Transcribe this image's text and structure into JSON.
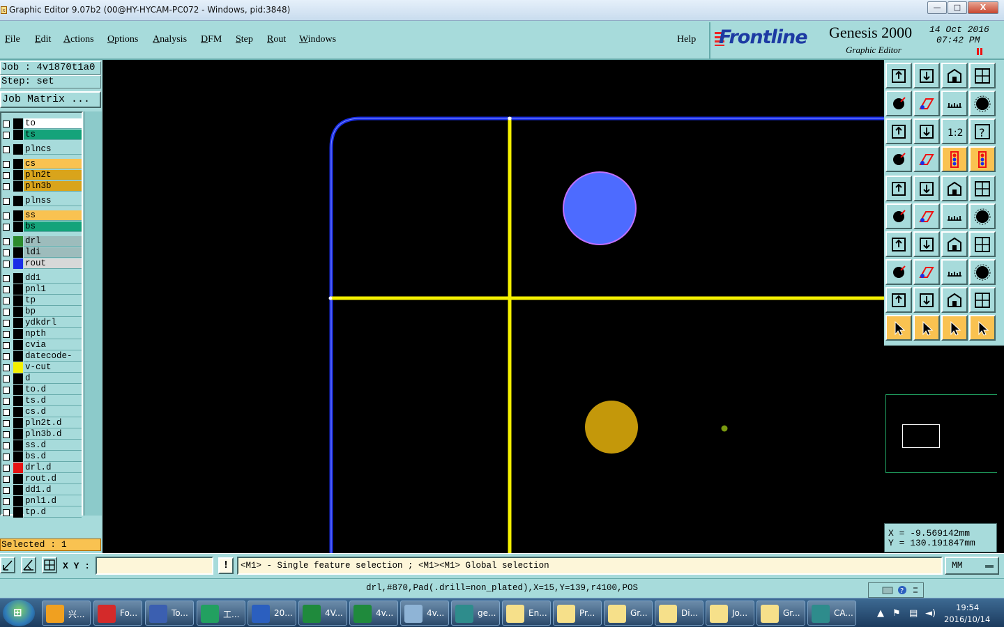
{
  "window": {
    "title": "Graphic Editor 9.07b2 (00@HY-HYCAM-PC072 - Windows, pid:3848)",
    "min_label": "—",
    "max_label": "□",
    "close_label": "X"
  },
  "menu": {
    "items": [
      "File",
      "Edit",
      "Actions",
      "Options",
      "Analysis",
      "DFM",
      "Step",
      "Rout",
      "Windows"
    ],
    "help": "Help"
  },
  "brand": {
    "logo": "Frontline",
    "product": "Genesis 2000",
    "subtitle": "Graphic Editor",
    "date": "14 Oct 2016",
    "time": "07:42 PM"
  },
  "job": {
    "job_label": "Job : 4v1870t1a0",
    "step_label": "Step: set",
    "matrix_button": "Job Matrix ..."
  },
  "layers": [
    {
      "name": "to",
      "bg": "#ffffff",
      "swatch": "#000000"
    },
    {
      "name": "ts",
      "bg": "#14a37a",
      "swatch": "#000000"
    },
    {
      "name": "plncs",
      "bg": "#a7dbdb",
      "swatch": "#000000"
    },
    {
      "name": "cs",
      "bg": "#f9c251",
      "swatch": "#000000"
    },
    {
      "name": "pln2t",
      "bg": "#d9a41b",
      "swatch": "#000000"
    },
    {
      "name": "pln3b",
      "bg": "#d9a41b",
      "swatch": "#000000"
    },
    {
      "name": "plnss",
      "bg": "#a7dbdb",
      "swatch": "#000000"
    },
    {
      "name": "ss",
      "bg": "#f9c251",
      "swatch": "#000000"
    },
    {
      "name": "bs",
      "bg": "#14a37a",
      "swatch": "#000000"
    },
    {
      "name": "drl",
      "bg": "#9dbcbc",
      "swatch": "#2d8a2d"
    },
    {
      "name": "ldi",
      "bg": "#9dbcbc",
      "swatch": "#000000"
    },
    {
      "name": "rout",
      "bg": "#d8d8d8",
      "swatch": "#1a2ee6"
    },
    {
      "name": "dd1",
      "bg": "#a7dbdb",
      "swatch": "#000000"
    },
    {
      "name": "pnl1",
      "bg": "#a7dbdb",
      "swatch": "#000000"
    },
    {
      "name": "tp",
      "bg": "#a7dbdb",
      "swatch": "#000000"
    },
    {
      "name": "bp",
      "bg": "#a7dbdb",
      "swatch": "#000000"
    },
    {
      "name": "ydkdrl",
      "bg": "#a7dbdb",
      "swatch": "#000000"
    },
    {
      "name": "npth",
      "bg": "#a7dbdb",
      "swatch": "#000000"
    },
    {
      "name": "cvia",
      "bg": "#a7dbdb",
      "swatch": "#000000"
    },
    {
      "name": "datecode-ts",
      "bg": "#a7dbdb",
      "swatch": "#000000"
    },
    {
      "name": "v-cut",
      "bg": "#a7dbdb",
      "swatch": "#f4f000"
    },
    {
      "name": "d",
      "bg": "#a7dbdb",
      "swatch": "#000000"
    },
    {
      "name": "to.d",
      "bg": "#a7dbdb",
      "swatch": "#000000"
    },
    {
      "name": "ts.d",
      "bg": "#a7dbdb",
      "swatch": "#000000"
    },
    {
      "name": "cs.d",
      "bg": "#a7dbdb",
      "swatch": "#000000"
    },
    {
      "name": "pln2t.d",
      "bg": "#a7dbdb",
      "swatch": "#000000"
    },
    {
      "name": "pln3b.d",
      "bg": "#a7dbdb",
      "swatch": "#000000"
    },
    {
      "name": "ss.d",
      "bg": "#a7dbdb",
      "swatch": "#000000"
    },
    {
      "name": "bs.d",
      "bg": "#a7dbdb",
      "swatch": "#000000"
    },
    {
      "name": "drl.d",
      "bg": "#a7dbdb",
      "swatch": "#e51414"
    },
    {
      "name": "rout.d",
      "bg": "#a7dbdb",
      "swatch": "#000000"
    },
    {
      "name": "dd1.d",
      "bg": "#a7dbdb",
      "swatch": "#000000"
    },
    {
      "name": "pnl1.d",
      "bg": "#a7dbdb",
      "swatch": "#000000"
    },
    {
      "name": "tp.d",
      "bg": "#a7dbdb",
      "swatch": "#000000"
    }
  ],
  "selected": "Selected : 1",
  "coords": {
    "x": "X = -9.569142mm",
    "y": "Y = 130.191847mm"
  },
  "input": {
    "xy_label": "X Y :",
    "xy_value": "",
    "warn": "!",
    "hint": "<M1> - Single feature selection ; <M1><M1> Global selection",
    "units": "MM"
  },
  "status": "drl,#870,Pad(.drill=non_plated),X=15,Y=139,r4100,POS",
  "colors": {
    "panel": "#a7dbdb",
    "rout": "#1a2ee6",
    "vcut": "#f4f000",
    "pad_blue": "#4d6bff",
    "pad_gold": "#c4980a",
    "highlight": "#f9c251"
  },
  "taskbar": {
    "start": "⊞",
    "tasks": [
      {
        "label": "兴...",
        "color": "#f0a020"
      },
      {
        "label": "Fo...",
        "color": "#d42a2a"
      },
      {
        "label": "To...",
        "color": "#3b5fb0"
      },
      {
        "label": "工...",
        "color": "#22a060"
      },
      {
        "label": "20...",
        "color": "#2b5fbf"
      },
      {
        "label": "4V...",
        "color": "#1f8a3c"
      },
      {
        "label": "4v...",
        "color": "#1f8a3c"
      },
      {
        "label": "4v...",
        "color": "#8fb4d6"
      },
      {
        "label": "ge...",
        "color": "#2e8c8c"
      },
      {
        "label": "En...",
        "color": "#f6e08a"
      },
      {
        "label": "Pr...",
        "color": "#f6e08a"
      },
      {
        "label": "Gr...",
        "color": "#f6e08a"
      },
      {
        "label": "Di...",
        "color": "#f6e08a"
      },
      {
        "label": "Jo...",
        "color": "#f6e08a"
      },
      {
        "label": "Gr...",
        "color": "#f6e08a"
      },
      {
        "label": "CA...",
        "color": "#2e8c8c"
      }
    ],
    "clock_time": "19:54",
    "clock_date": "2016/10/14"
  }
}
